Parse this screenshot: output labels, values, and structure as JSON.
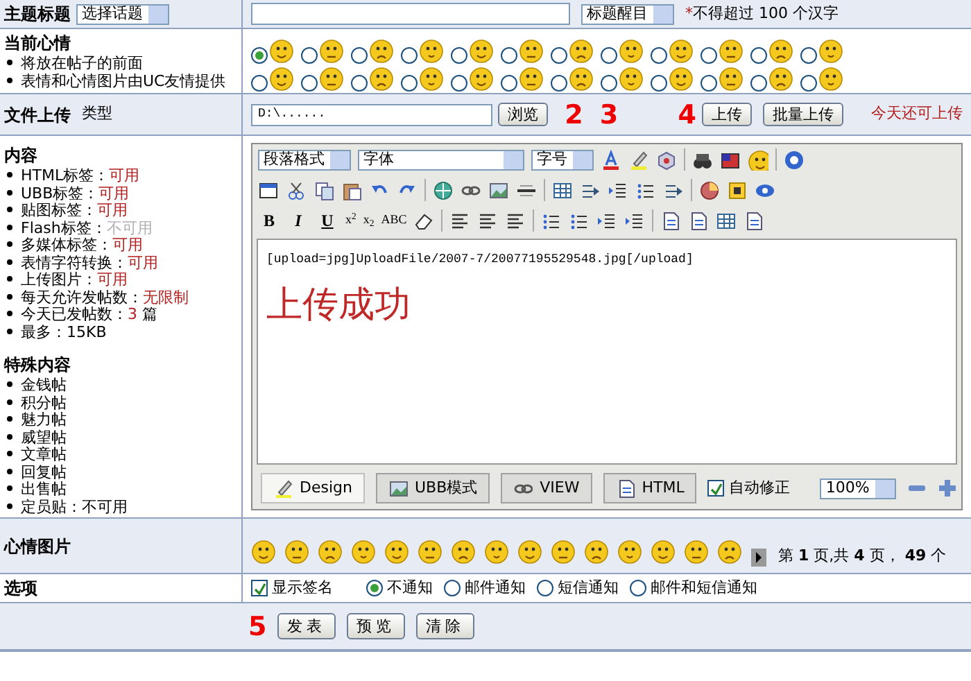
{
  "subject_row": {
    "label": "主题标题",
    "topic_select": "选择话题",
    "style_select": "标题醒目",
    "required_mark": "*",
    "hint": "不得超过 100 个汉字"
  },
  "mood_row": {
    "label": "当前心情",
    "notes": [
      "将放在帖子的前面",
      "表情和心情图片由UC友情提供"
    ],
    "moods": [
      {
        "selected": true
      },
      {
        "selected": false
      },
      {
        "selected": false
      },
      {
        "selected": false
      },
      {
        "selected": false
      },
      {
        "selected": false
      },
      {
        "selected": false
      },
      {
        "selected": false
      },
      {
        "selected": false
      },
      {
        "selected": false
      },
      {
        "selected": false
      },
      {
        "selected": false
      },
      {
        "selected": false
      },
      {
        "selected": false
      },
      {
        "selected": false
      },
      {
        "selected": false
      },
      {
        "selected": false
      },
      {
        "selected": false
      },
      {
        "selected": false
      },
      {
        "selected": false
      },
      {
        "selected": false
      },
      {
        "selected": false
      },
      {
        "selected": false
      },
      {
        "selected": false
      }
    ]
  },
  "upload_row": {
    "label": "文件上传",
    "type_label": "类型",
    "file_value": "D:\\......",
    "browse_button": "浏览",
    "step_marks": [
      "2",
      "3"
    ],
    "upload_mark": "4",
    "upload_button": "上传",
    "batch_button": "批量上传",
    "quota_text": "今天还可上传"
  },
  "content_row": {
    "label": "内容",
    "permissions": [
      {
        "label": "HTML标签：",
        "value": "可用",
        "kind": "on"
      },
      {
        "label": "UBB标签：",
        "value": "可用",
        "kind": "on"
      },
      {
        "label": "贴图标签：",
        "value": "可用",
        "kind": "on"
      },
      {
        "label": "Flash标签：",
        "value": "不可用",
        "kind": "off"
      },
      {
        "label": "多媒体标签：",
        "value": "可用",
        "kind": "on"
      },
      {
        "label": "表情字符转换：",
        "value": "可用",
        "kind": "on"
      },
      {
        "label": "上传图片：",
        "value": "可用",
        "kind": "on"
      },
      {
        "label": "每天允许发帖数：",
        "value": "无限制",
        "kind": "on"
      },
      {
        "label": "今天已发帖数：",
        "value": "3",
        "suffix": "篇",
        "kind": "on"
      },
      {
        "label": "最多：15KB",
        "kind": "plain"
      }
    ],
    "special_label": "特殊内容",
    "special_items": [
      "金钱帖",
      "积分帖",
      "魅力帖",
      "威望帖",
      "文章帖",
      "回复帖",
      "出售帖",
      "定员贴：不可用"
    ]
  },
  "editor": {
    "paragraph_select": "段落格式",
    "font_select": "字体",
    "size_select": "字号",
    "format_buttons": [
      "B",
      "I",
      "U",
      "x$^{2}$",
      "x$_{2}$",
      "ABC"
    ],
    "code_line": "[upload=jpg]UploadFile/2007-7/20077195529548.jpg[/upload]",
    "message": "上传成功",
    "modes": [
      {
        "label": "Design",
        "selected": true
      },
      {
        "label": "UBB模式",
        "selected": false
      },
      {
        "label": "VIEW",
        "selected": false
      },
      {
        "label": "HTML",
        "selected": false
      }
    ],
    "auto_fix": {
      "label": "自动修正",
      "checked": true
    },
    "zoom_select": "100%"
  },
  "emoticon_row": {
    "label": "心情图片",
    "pager": "第 **1** 页,共 **4** 页， **49** 个"
  },
  "options_row": {
    "label": "选项",
    "signature": {
      "label": "显示签名",
      "checked": true
    },
    "notify": [
      {
        "label": "不通知",
        "selected": true
      },
      {
        "label": "邮件通知",
        "selected": false
      },
      {
        "label": "短信通知",
        "selected": false
      },
      {
        "label": "邮件和短信通知",
        "selected": false
      }
    ]
  },
  "actions": {
    "step_mark": "5",
    "buttons": [
      "发表",
      "预览",
      "清除"
    ]
  }
}
